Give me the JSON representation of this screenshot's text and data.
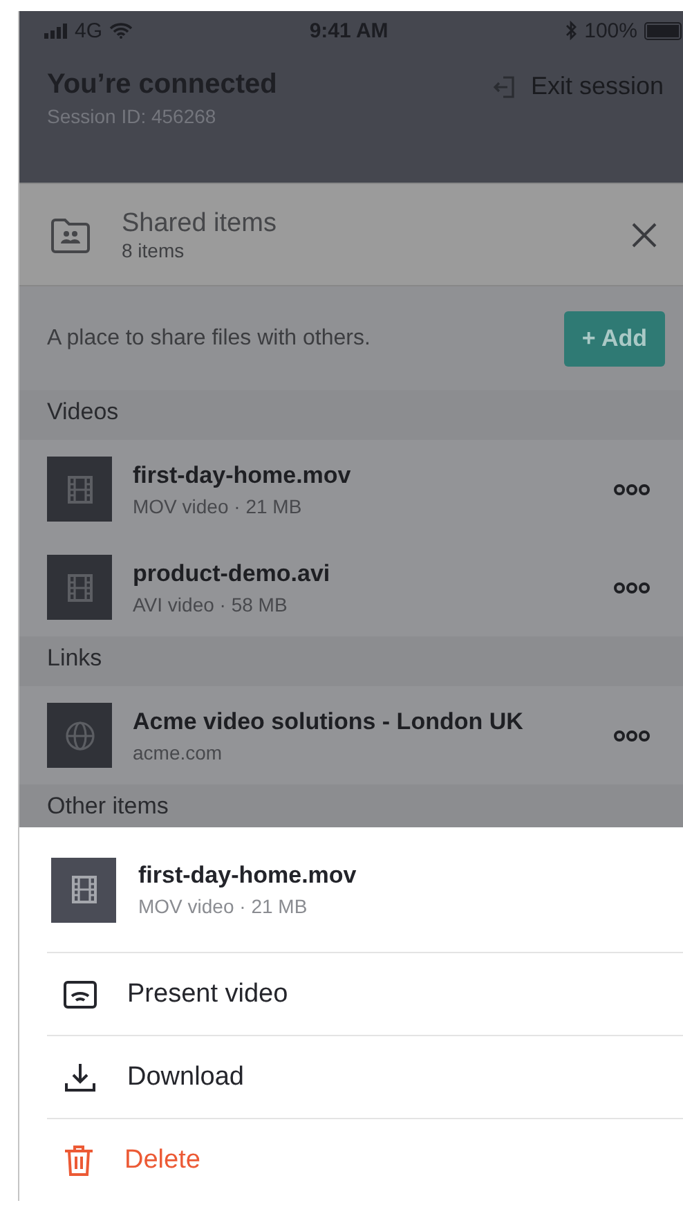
{
  "status_bar": {
    "network": "4G",
    "time": "9:41 AM",
    "battery": "100%"
  },
  "session": {
    "title": "You’re connected",
    "session_id": "Session ID: 456268",
    "exit_label": "Exit session"
  },
  "panel": {
    "title": "Shared items",
    "count": "8 items",
    "description": "A place to share files with others.",
    "add_label": "+ Add"
  },
  "sections": [
    {
      "title": "Videos",
      "items": [
        {
          "kind": "video",
          "name": "first-day-home.mov",
          "detail": "MOV video · 21 MB"
        },
        {
          "kind": "video",
          "name": "product-demo.avi",
          "detail": "AVI video · 58 MB"
        }
      ]
    },
    {
      "title": "Links",
      "items": [
        {
          "kind": "link",
          "name": "Acme video solutions - London UK",
          "detail": "acme.com"
        }
      ]
    },
    {
      "title": "Other items"
    }
  ],
  "sheet": {
    "item": {
      "kind": "video",
      "name": "first-day-home.mov",
      "detail": "MOV video · 21 MB"
    },
    "actions": [
      {
        "kind": "present",
        "label": "Present video",
        "danger": false
      },
      {
        "kind": "download",
        "label": "Download",
        "danger": false
      },
      {
        "kind": "delete",
        "label": "Delete",
        "danger": true
      }
    ]
  }
}
